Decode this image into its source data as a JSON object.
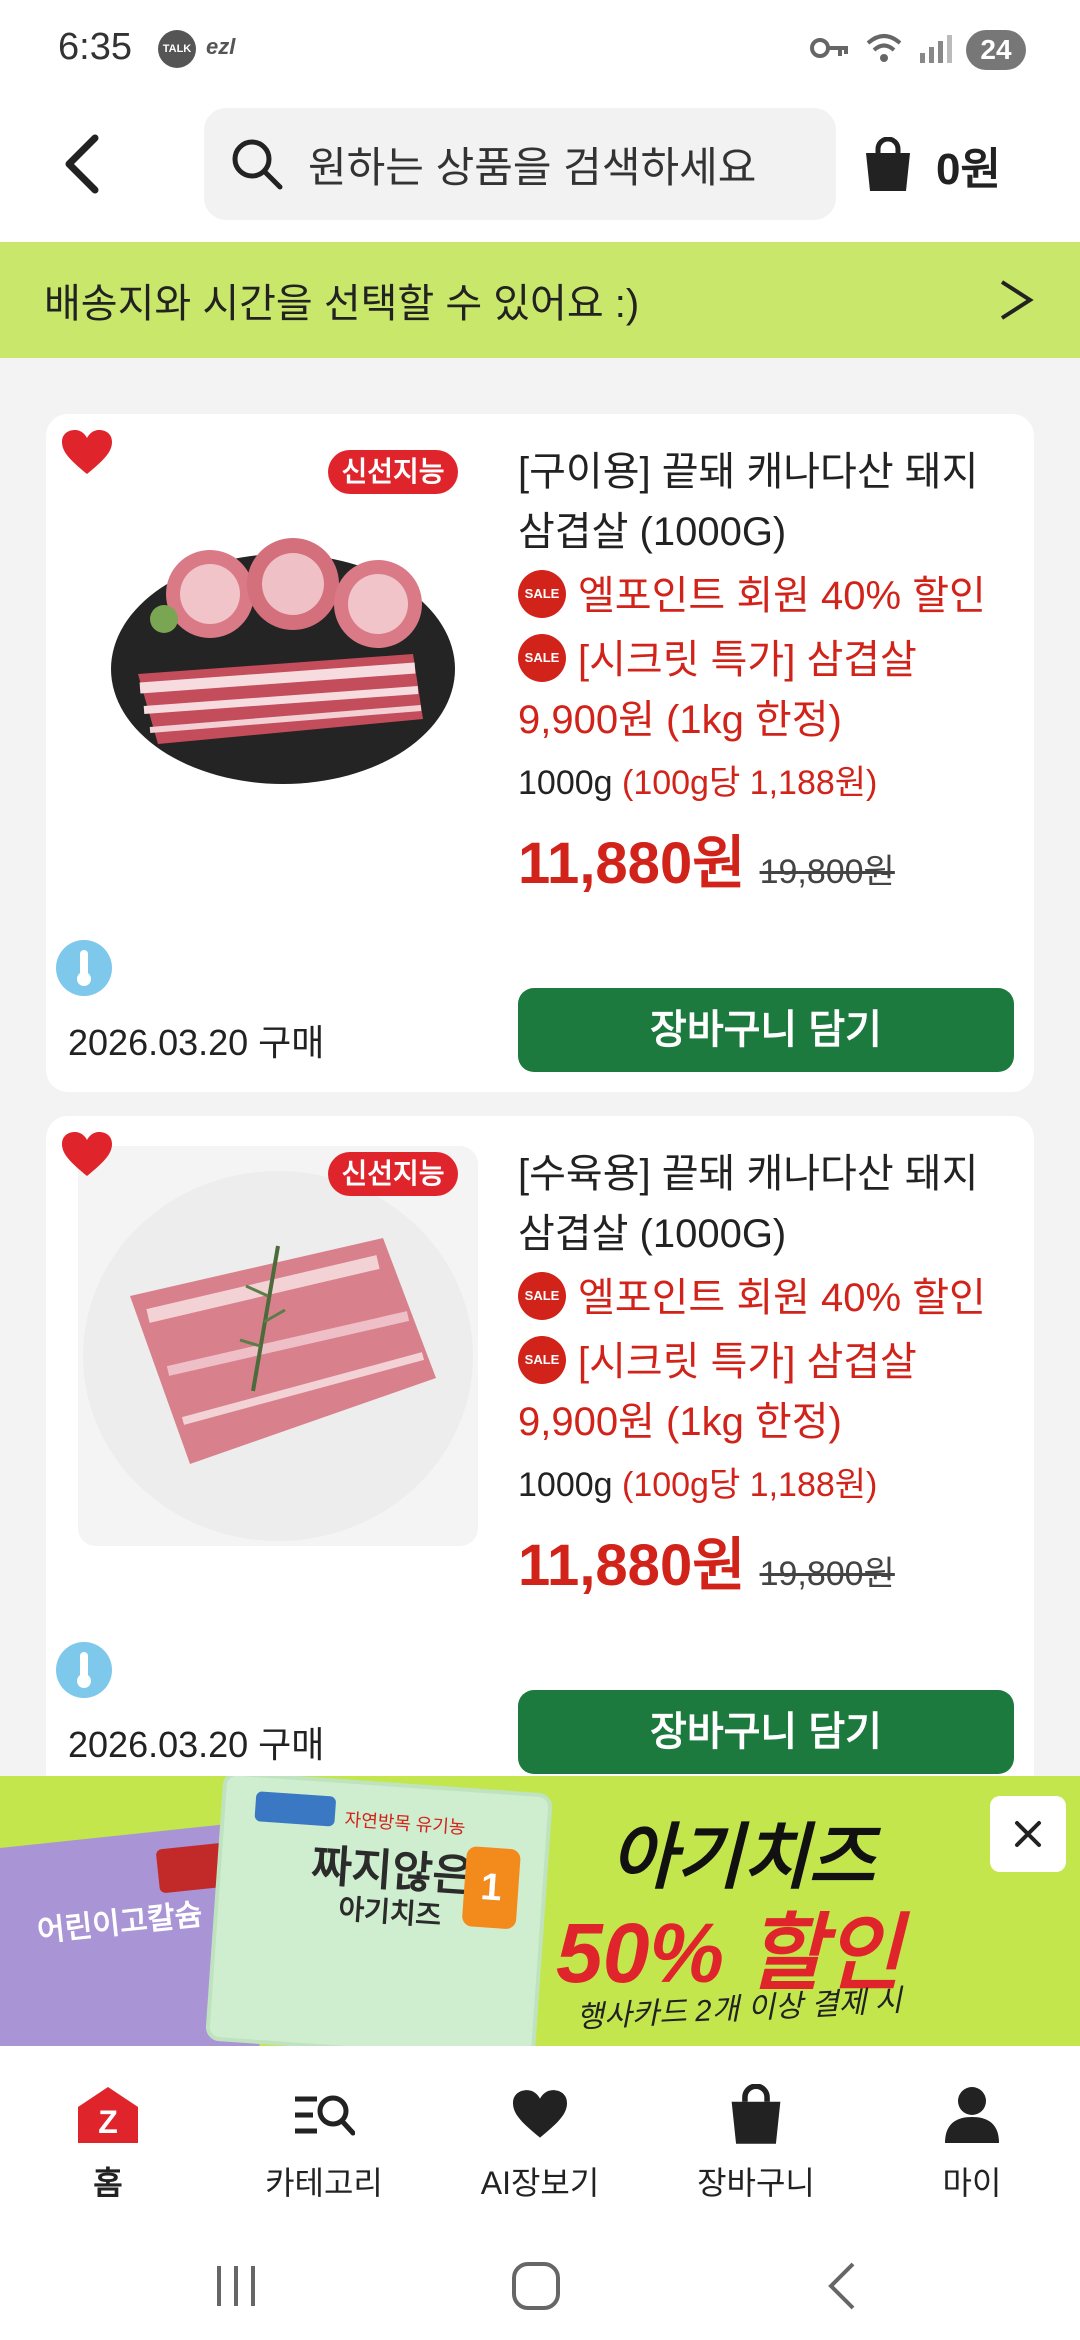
{
  "status_bar": {
    "time": "6:35",
    "talk_label": "TALK",
    "ezl_label": "ezl",
    "battery": "24"
  },
  "header": {
    "search_placeholder": "원하는 상품을 검색하세요",
    "cart_amount": "0원"
  },
  "delivery_banner": {
    "text": "배송지와 시간을 선택할 수 있어요 :)",
    "chevron": ">"
  },
  "products": [
    {
      "badge": "신선지능",
      "title": "[구이용] 끝돼 캐나다산 돼지 삼겹살 (1000G)",
      "promo_1": "엘포인트 회원 40% 할인",
      "promo_2": "[시크릿 특가] 삼겹살 9,900원 (1kg 한정)",
      "weight": "1000g",
      "unit_price": "(100g당 1,188원)",
      "price": "11,880원",
      "original_price": "19,800원",
      "purchase_date": "2026.03.20 구매",
      "cart_button": "장바구니 담기"
    },
    {
      "badge": "신선지능",
      "title": "[수육용] 끝돼 캐나다산 돼지 삼겹살 (1000G)",
      "promo_1": "엘포인트 회원 40% 할인",
      "promo_2": "[시크릿 특가] 삼겹살 9,900원 (1kg 한정)",
      "weight": "1000g",
      "unit_price": "(100g당 1,188원)",
      "price": "11,880원",
      "original_price": "19,800원",
      "purchase_date": "2026.03.20 구매",
      "cart_button": "장바구니 담기"
    }
  ],
  "sale_label": "SALE",
  "ad_banner": {
    "title": "아기치즈",
    "discount": "50% 할인",
    "note": "행사카드 2개 이상 결제 시",
    "pack_1_title": "어린이고칼슘",
    "pack_2_top": "자연방목 유기농",
    "pack_2_title": "짜지않은",
    "pack_2_sub": "아기치즈",
    "pack_2_step": "1",
    "close": "✕"
  },
  "bottom_nav": {
    "items": [
      {
        "label": "홈",
        "icon": "home-icon"
      },
      {
        "label": "카테고리",
        "icon": "category-search-icon"
      },
      {
        "label": "AI장보기",
        "icon": "heart-icon"
      },
      {
        "label": "장바구니",
        "icon": "shopping-bag-icon"
      },
      {
        "label": "마이",
        "icon": "person-icon"
      }
    ],
    "home_logo_letter": "Z"
  },
  "colors": {
    "accent_green": "#1c7a3e",
    "banner_lime": "#c9e76b",
    "price_red": "#d2231a",
    "badge_red": "#e0242c"
  }
}
